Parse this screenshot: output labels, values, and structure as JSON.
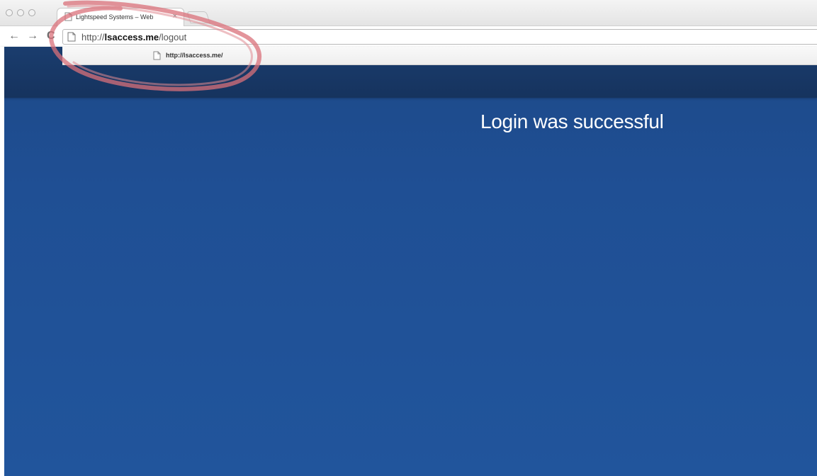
{
  "browser": {
    "tab": {
      "title": "Lightspeed Systems – Web",
      "close_glyph": "×",
      "favicon": "page-icon"
    },
    "toolbar": {
      "back_glyph": "←",
      "forward_glyph": "→",
      "reload_glyph": "C",
      "url": {
        "scheme": "http://",
        "domain": "lsaccess.me",
        "path": "/logout"
      }
    },
    "suggestion": {
      "url": "http://lsaccess.me/",
      "icon": "page-icon"
    },
    "annotation_color": "#d9707a"
  },
  "page": {
    "message": "Login was successful",
    "header_color": "#16335e",
    "background_color": "#1f4f94"
  }
}
